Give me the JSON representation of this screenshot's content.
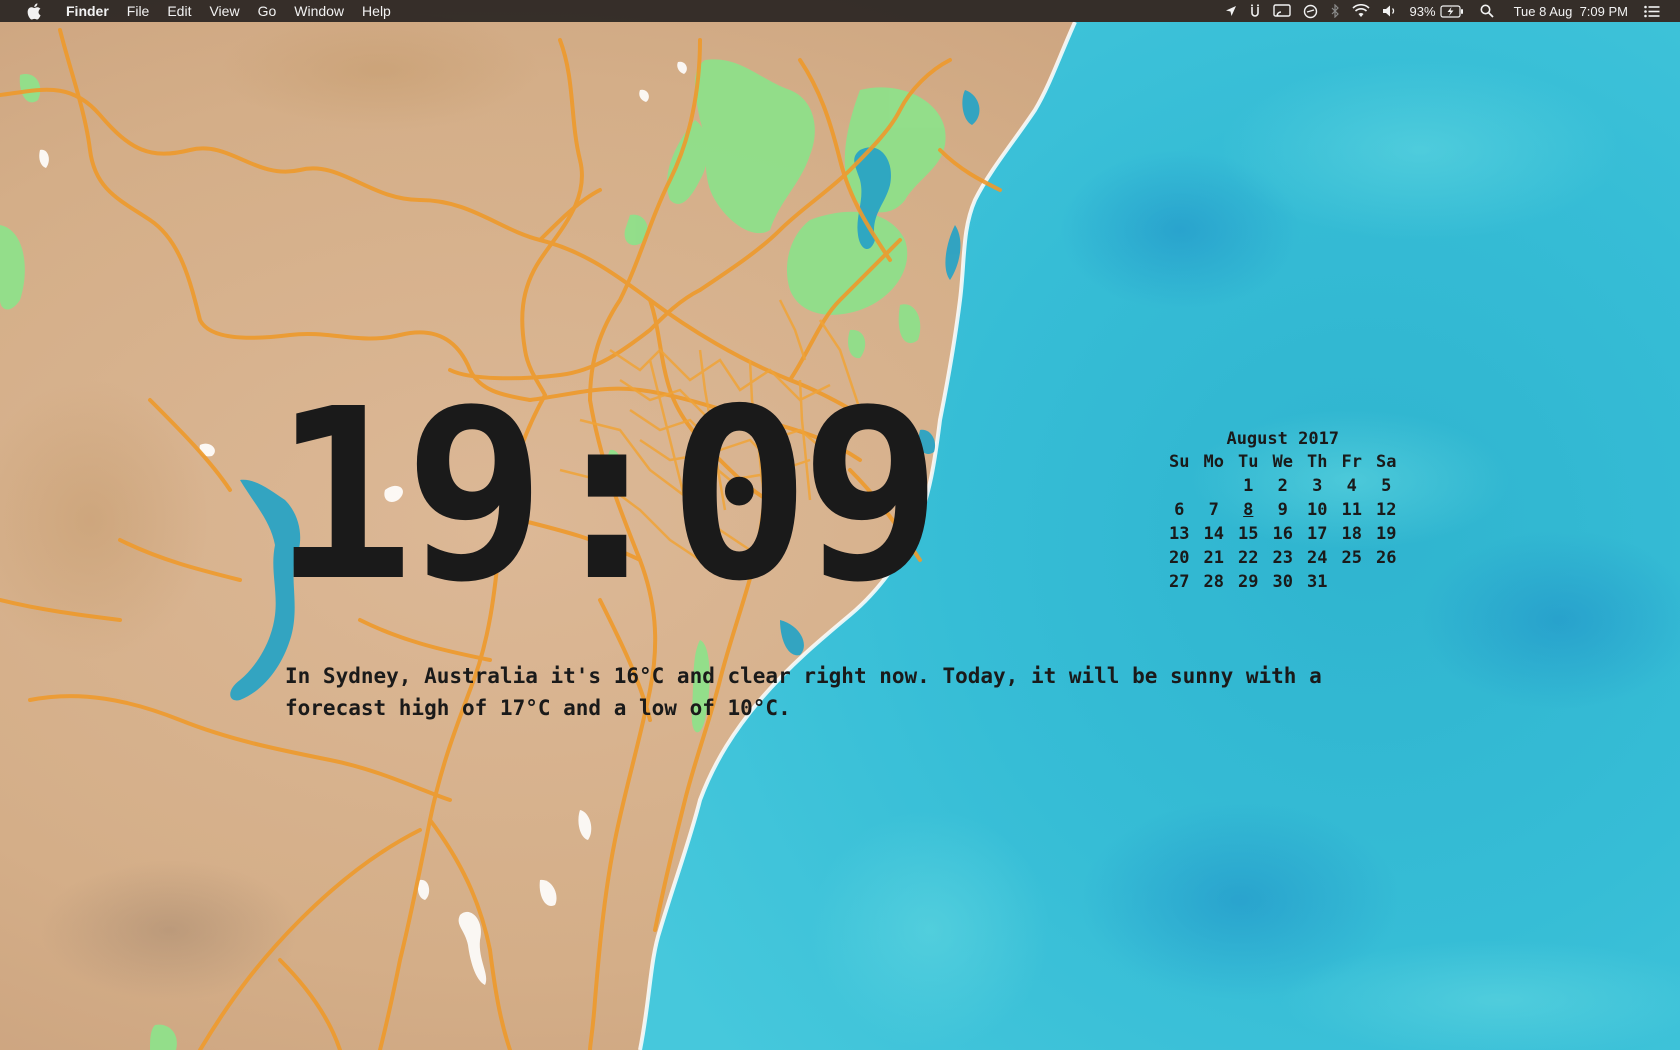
{
  "menubar": {
    "apple_icon": "apple-icon",
    "app_name": "Finder",
    "menus": [
      "File",
      "Edit",
      "View",
      "Go",
      "Window",
      "Help"
    ],
    "status_icons": [
      "location-arrow-icon",
      "u-icon",
      "screen-mirroring-icon",
      "do-not-disturb-icon",
      "bluetooth-icon",
      "wifi-icon",
      "volume-icon"
    ],
    "battery_percent": "93%",
    "battery_icon": "battery-charging-icon",
    "search_icon": "spotlight-search-icon",
    "datetime": "Tue 8 Aug  7:09 PM",
    "notification_icon": "notification-center-icon"
  },
  "clock": {
    "time": "19:09"
  },
  "weather": {
    "text": "In Sydney, Australia it's 16°C and clear right now. Today, it will be sunny with a forecast high of 17°C and a low of 10°C."
  },
  "calendar": {
    "title": "August 2017",
    "weekdays": [
      "Su",
      "Mo",
      "Tu",
      "We",
      "Th",
      "Fr",
      "Sa"
    ],
    "weeks": [
      [
        "",
        "",
        "1",
        "2",
        "3",
        "4",
        "5"
      ],
      [
        "6",
        "7",
        "8",
        "9",
        "10",
        "11",
        "12"
      ],
      [
        "13",
        "14",
        "15",
        "16",
        "17",
        "18",
        "19"
      ],
      [
        "20",
        "21",
        "22",
        "23",
        "24",
        "25",
        "26"
      ],
      [
        "27",
        "28",
        "29",
        "30",
        "31",
        "",
        ""
      ]
    ],
    "today": "8"
  },
  "colors": {
    "land": "#d9b894",
    "ocean": "#35b9d2",
    "roads": "#ee9a2c",
    "parks": "#8fe08a",
    "water": "#2aa3c4",
    "text": "#1a1a1a"
  }
}
